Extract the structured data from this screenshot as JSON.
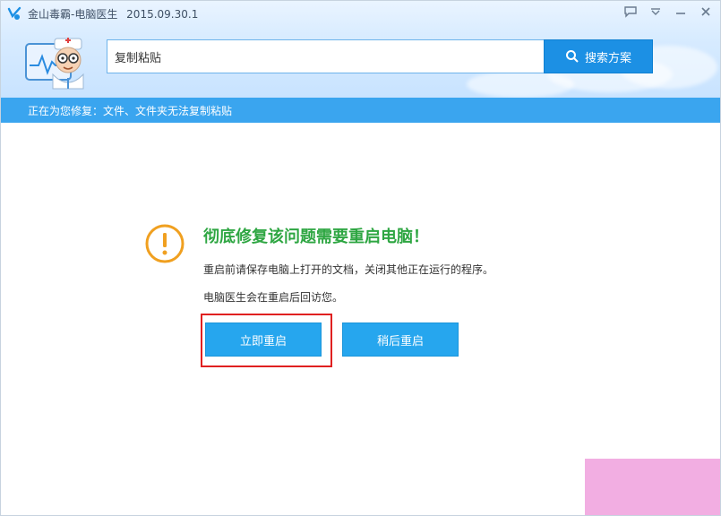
{
  "window": {
    "title": "金山毒霸-电脑医生",
    "version": "2015.09.30.1"
  },
  "controls": {
    "feedback_icon": "chat-bubble-icon",
    "menu_icon": "dropdown-icon",
    "minimize_icon": "minimize-icon",
    "close_icon": "close-icon"
  },
  "search": {
    "value": "复制粘贴",
    "button_label": "搜索方案"
  },
  "status": {
    "text": "正在为您修复：文件、文件夹无法复制粘贴"
  },
  "dialog": {
    "heading": "彻底修复该问题需要重启电脑！",
    "line1": "重启前请保存电脑上打开的文档，关闭其他正在运行的程序。",
    "line2": "电脑医生会在重启后回访您。",
    "restart_now": "立即重启",
    "restart_later": "稍后重启"
  },
  "colors": {
    "accent": "#1c90e4",
    "heading_green": "#2ea642",
    "warning_orange": "#f0a020",
    "highlight_red": "#e02020"
  }
}
